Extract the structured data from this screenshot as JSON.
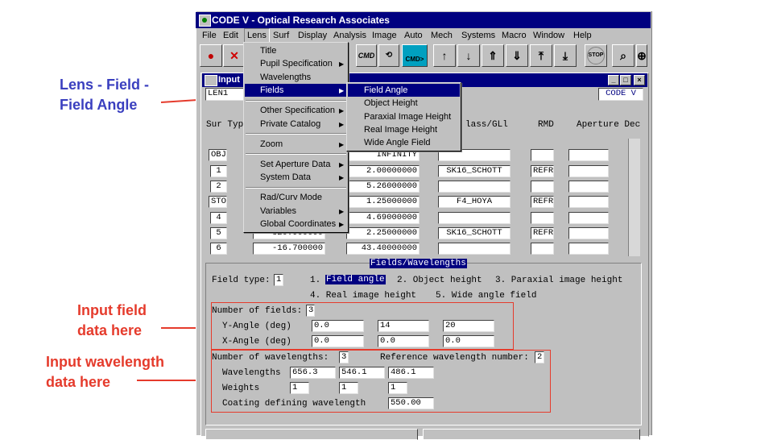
{
  "app": {
    "title": "CODE V - Optical Research Associates",
    "menu": [
      "File",
      "Edit",
      "Lens",
      "Surf",
      "Display",
      "Analysis",
      "Image",
      "Auto",
      "Mech",
      "Systems",
      "Macro",
      "Window",
      "Help"
    ],
    "toolbar_labels": {
      "cmd": "CMD",
      "cmd2": "CMD>",
      "stop": "STOP"
    }
  },
  "lens_menu": {
    "items": [
      "Title",
      "Pupil Specification",
      "Wavelengths",
      "Fields",
      "Other Specification",
      "Private Catalog",
      "Zoom",
      "Set Aperture Data",
      "System Data",
      "Rad/Curv Mode",
      "Variables",
      "Global Coordinates"
    ]
  },
  "fields_submenu": {
    "items": [
      "Field Angle",
      "Object Height",
      "Paraxial Image Height",
      "Real Image Height",
      "Wide Angle Field"
    ]
  },
  "editor": {
    "window_title": "Input",
    "lens_name": "LEN1",
    "code_v_badge": "CODE V",
    "headers": {
      "sur_type": "Sur Typ",
      "glass": "lass/GLl",
      "rmd": "RMD",
      "aperture": "Aperture Dec"
    },
    "rows": [
      {
        "sur": "OBJ",
        "radius": "",
        "thickness": "INFINITY",
        "glass": "",
        "rmd": ""
      },
      {
        "sur": "1",
        "radius": "",
        "thickness": "2.00000000",
        "glass": "SK16_SCHOTT",
        "rmd": "REFR"
      },
      {
        "sur": "2",
        "radius": "",
        "thickness": "5.26000000",
        "glass": "",
        "rmd": ""
      },
      {
        "sur": "STO",
        "radius": "",
        "thickness": "1.25000000",
        "glass": "F4_HOYA",
        "rmd": "REFR"
      },
      {
        "sur": "4",
        "radius": "",
        "thickness": "4.69000000",
        "glass": "",
        "rmd": ""
      },
      {
        "sur": "5",
        "radius": "320.900000",
        "thickness": "2.25000000",
        "glass": "SK16_SCHOTT",
        "rmd": "REFR"
      },
      {
        "sur": "6",
        "radius": "-16.700000",
        "thickness": "43.40000000",
        "glass": "",
        "rmd": ""
      }
    ]
  },
  "fields_wavelengths": {
    "title": "Fields/Wavelengths",
    "field_type_label": "Field type:",
    "field_type_value": "1",
    "options": [
      "1.",
      "Field angle",
      "2. Object height",
      "3. Paraxial image height",
      "4. Real image height",
      "5. Wide angle field"
    ],
    "num_fields_label": "Number of fields:",
    "num_fields": "3",
    "y_angle_label": "Y-Angle (deg)",
    "y_angles": [
      "0.0",
      "14",
      "20"
    ],
    "x_angle_label": "X-Angle (deg)",
    "x_angles": [
      "0.0",
      "0.0",
      "0.0"
    ],
    "num_wl_label": "Number of wavelengths:",
    "num_wl": "3",
    "ref_wl_label": "Reference wavelength number:",
    "ref_wl": "2",
    "wl_label": "Wavelengths",
    "wavelengths": [
      "656.3",
      "546.1",
      "486.1"
    ],
    "weights_label": "Weights",
    "weights": [
      "1",
      "1",
      "1"
    ],
    "coating_label": "Coating defining wavelength",
    "coating_wl": "550.00"
  },
  "annotations": {
    "lens_field": [
      "Lens - Field -",
      "Field Angle"
    ],
    "input_field": [
      "Input field",
      "data here"
    ],
    "input_wavelength": [
      "Input wavelength",
      "data here"
    ],
    "colors": {
      "blue": "#3a3fbf",
      "red": "#e53b2c"
    }
  }
}
